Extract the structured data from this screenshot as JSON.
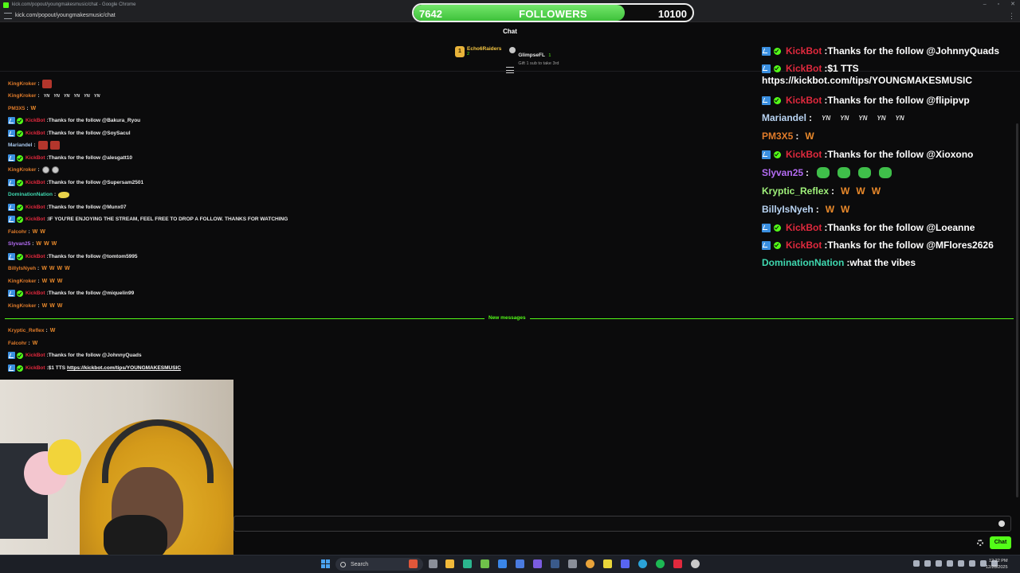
{
  "browser": {
    "title": "kick.com/popout/youngmakesmusic/chat - Google Chrome",
    "url": "kick.com/popout/youngmakesmusic/chat"
  },
  "goal": {
    "current": "7642",
    "label": "FOLLOWERS",
    "target": "10100",
    "progress_fraction": 0.757
  },
  "chat": {
    "header": "Chat",
    "send_label": "Chat",
    "new_messages_label": "New messages",
    "gifters": [
      {
        "rank": "1",
        "name": "Echo6Raiders",
        "count": "2"
      },
      {
        "name": "GlimpseFL",
        "count": "1",
        "note": "Gift 1 sub to take 3rd"
      }
    ],
    "messages": [
      {
        "user": "KingKroker",
        "color": "#e07b2a",
        "text": "",
        "emotes": "img"
      },
      {
        "user": "KingKroker",
        "color": "#e07b2a",
        "text": "",
        "emotes": "YN YN YN YN YN YN"
      },
      {
        "user": "PM3X5",
        "color": "#e07b2a",
        "text": "",
        "emotes": "W"
      },
      {
        "user": "KickBot",
        "bot": true,
        "color": "#e0293d",
        "text": "Thanks for the follow @Bakura_Ryou"
      },
      {
        "user": "KickBot",
        "bot": true,
        "color": "#e0293d",
        "text": "Thanks for the follow @SoySacul"
      },
      {
        "user": "Mariandel",
        "color": "#a9c9ef",
        "text": "",
        "emotes": "img2"
      },
      {
        "user": "KickBot",
        "bot": true,
        "color": "#e0293d",
        "text": "Thanks for the follow @alesgatt10"
      },
      {
        "user": "KingKroker",
        "color": "#e07b2a",
        "text": "",
        "emotes": "round"
      },
      {
        "user": "KickBot",
        "bot": true,
        "color": "#e0293d",
        "text": "Thanks for the follow @Supersam2501"
      },
      {
        "user": "DominationNation",
        "color": "#3fd8b0",
        "text": "",
        "emotes": "fish"
      },
      {
        "user": "KickBot",
        "bot": true,
        "color": "#e0293d",
        "text": "Thanks for the follow @Munx07"
      },
      {
        "user": "KickBot",
        "bot": true,
        "color": "#e0293d",
        "text": "IF YOU'RE ENJOYING THE STREAM, FEEL FREE TO DROP A FOLLOW. THANKS FOR WATCHING"
      },
      {
        "user": "Falcohr",
        "color": "#e07b2a",
        "text": "",
        "emotes": "W W"
      },
      {
        "user": "Slyvan25",
        "color": "#b36bf2",
        "text": "",
        "emotes": "W W W"
      },
      {
        "user": "KickBot",
        "bot": true,
        "color": "#e0293d",
        "text": "Thanks for the follow @tomtom5995"
      },
      {
        "user": "BillyIsNyeh",
        "color": "#e07b2a",
        "text": "",
        "emotes": "W W W W"
      },
      {
        "user": "KingKroker",
        "color": "#e07b2a",
        "text": "",
        "emotes": "W W W"
      },
      {
        "user": "KickBot",
        "bot": true,
        "color": "#e0293d",
        "text": "Thanks for the follow @miquelin99"
      },
      {
        "user": "KingKroker",
        "color": "#e07b2a",
        "text": "",
        "emotes": "W W W"
      }
    ],
    "new_messages": [
      {
        "user": "Kryptic_Reflex",
        "color": "#e07b2a",
        "text": "",
        "emotes": "W"
      },
      {
        "user": "Falcohr",
        "color": "#e07b2a",
        "text": "",
        "emotes": "W"
      },
      {
        "user": "KickBot",
        "bot": true,
        "color": "#e0293d",
        "text": "Thanks for the follow @JohnnyQuads"
      },
      {
        "user": "KickBot",
        "bot": true,
        "color": "#e0293d",
        "text": "$1 TTS",
        "link": "https://kickbot.com/tips/YOUNGMAKESMUSIC"
      }
    ]
  },
  "overlay": {
    "messages": [
      {
        "user": "KickBot",
        "bot": true,
        "color": "#e0293d",
        "text": "Thanks for the follow @JohnnyQuads"
      },
      {
        "user": "KickBot",
        "bot": true,
        "color": "#e0293d",
        "text": "$1 TTS"
      },
      {
        "wrap": "https://kickbot.com/tips/YOUNGMAKESMUSIC"
      },
      {
        "user": "KickBot",
        "bot": true,
        "color": "#e0293d",
        "text": "Thanks for the follow @flipipvp"
      },
      {
        "user": "Mariandel",
        "color": "#b8d3f2",
        "text": "",
        "emotes": "YN YN YN YN YN"
      },
      {
        "user": "PM3X5",
        "color": "#e07b2a",
        "text": "",
        "emotes": "W"
      },
      {
        "user": "KickBot",
        "bot": true,
        "color": "#e0293d",
        "text": "Thanks for the follow @Xioxono"
      },
      {
        "user": "Slyvan25",
        "color": "#b36bf2",
        "text": "",
        "emotes": "frog4"
      },
      {
        "user": "Kryptic_Reflex",
        "color": "#9ff07a",
        "text": "",
        "emotes": "W W W"
      },
      {
        "user": "BillyIsNyeh",
        "color": "#b8d3f2",
        "text": "",
        "emotes": "W W"
      },
      {
        "user": "KickBot",
        "bot": true,
        "color": "#e0293d",
        "text": "Thanks for the follow @Loeanne"
      },
      {
        "user": "KickBot",
        "bot": true,
        "color": "#e0293d",
        "text": "Thanks for the follow @MFlores2626"
      },
      {
        "user": "DominationNation",
        "color": "#3fd8b0",
        "text": "what the vibes"
      }
    ]
  },
  "taskbar": {
    "search_label": "Search",
    "time": "12:22 PM",
    "date": "12/28/2025"
  }
}
